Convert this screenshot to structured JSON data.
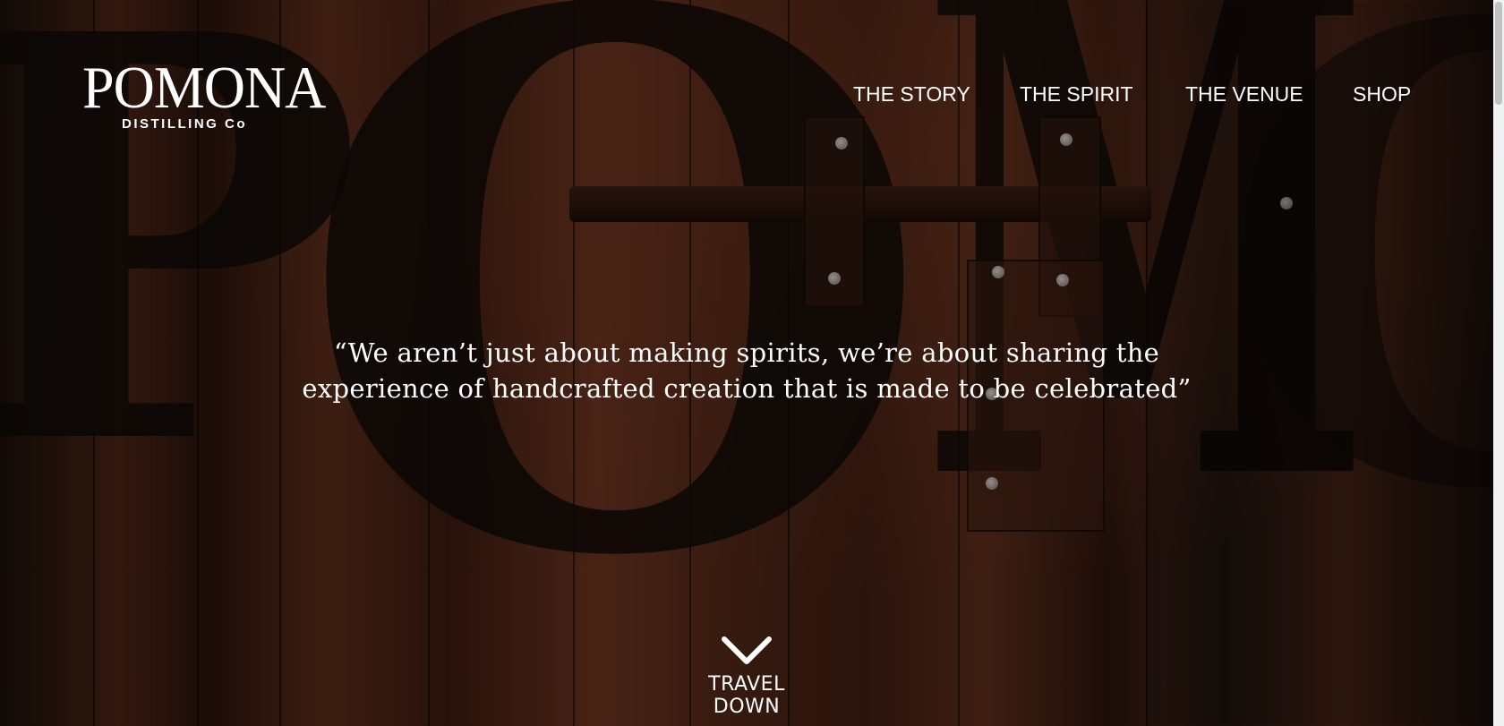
{
  "brand": {
    "name": "POMONA",
    "tagline": "DISTILLING Co"
  },
  "nav": {
    "items": [
      {
        "label": "THE STORY"
      },
      {
        "label": "THE SPIRIT"
      },
      {
        "label": "THE VENUE"
      },
      {
        "label": "SHOP"
      }
    ]
  },
  "hero": {
    "quote_line1": "“We aren’t just about making spirits, we’re about sharing the",
    "quote_line2": "experience of handcrafted creation that is made to be celebrated”",
    "scroll_label": "TRAVEL DOWN",
    "scroll_icon": "chevron-down-icon"
  },
  "colors": {
    "text": "#ffffff",
    "wood": "#5a2c1b",
    "scrollbar_thumb": "#c1c1c1"
  }
}
